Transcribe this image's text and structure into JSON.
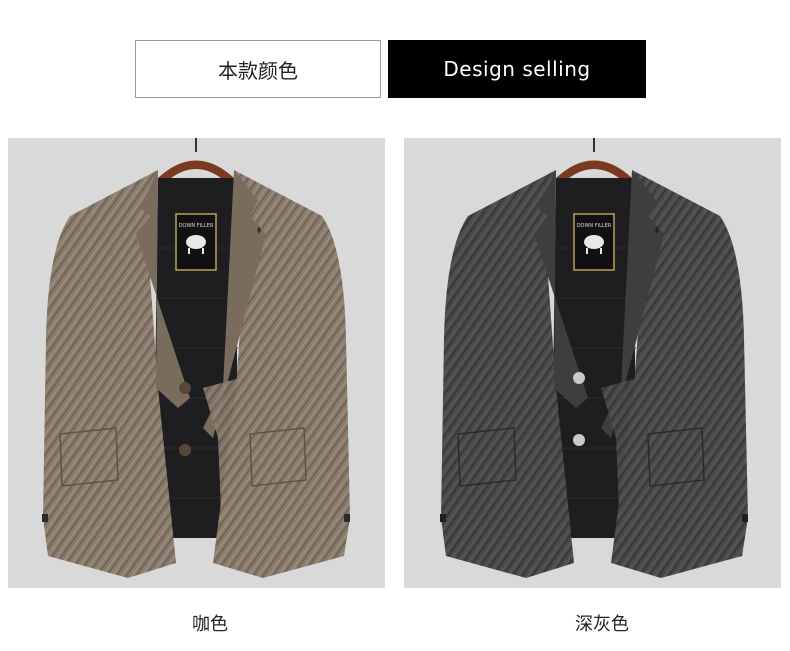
{
  "tabs": {
    "current_colors": "本款颜色",
    "design_selling": "Design selling"
  },
  "products": [
    {
      "caption": "咖色",
      "label_text": "DOWN FILLER",
      "colors": {
        "wool": "#8a7b6c",
        "wool_dark": "#6b5f52",
        "wool_light": "#a39584",
        "button": "#5a4636"
      }
    },
    {
      "caption": "深灰色",
      "label_text": "DOWN FILLER",
      "colors": {
        "wool": "#4a4a4c",
        "wool_dark": "#343436",
        "wool_light": "#5e5e60",
        "button": "#c9c9c9"
      }
    }
  ],
  "colors": {
    "panel_background": "#d9d9d9",
    "active_tab_bg": "#000000",
    "hanger": "#7a3a22",
    "lining": "#1e1e20"
  }
}
